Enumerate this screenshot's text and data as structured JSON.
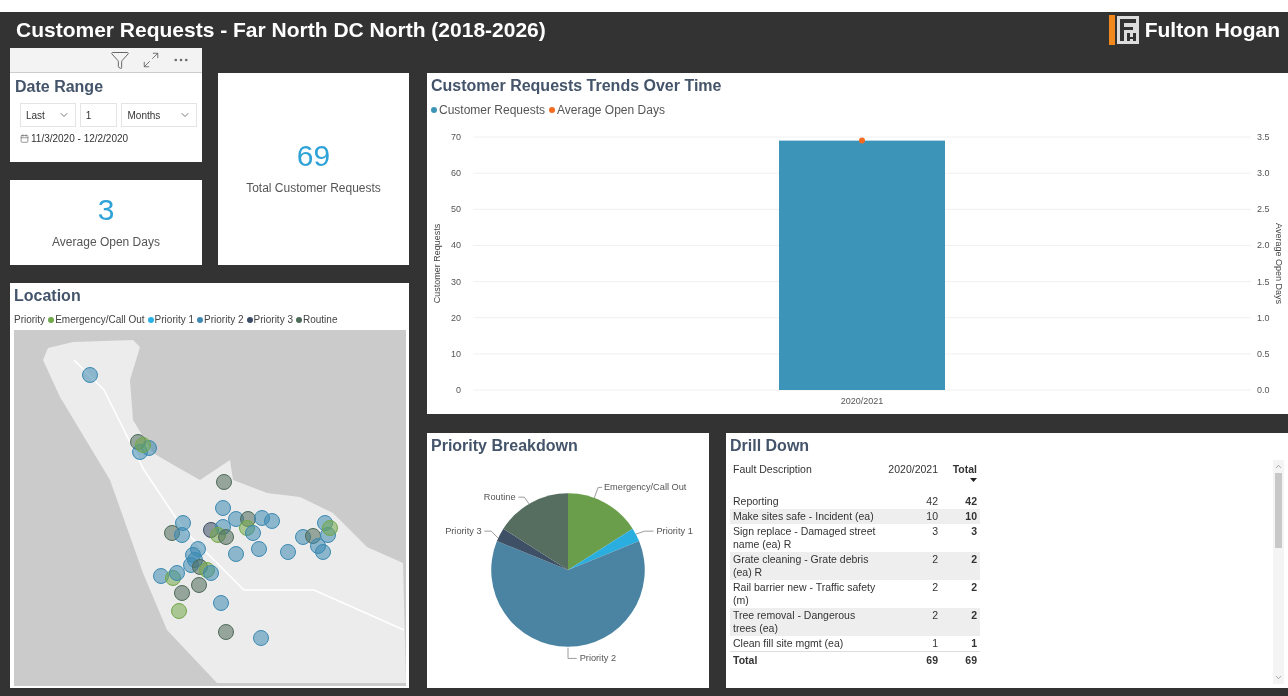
{
  "header": {
    "title": "Customer Requests - Far North DC North (2018-2026)",
    "logo_text": "Fulton Hogan"
  },
  "date_range": {
    "title": "Date Range",
    "fields": [
      {
        "kind": "dropdown",
        "value": "Last"
      },
      {
        "kind": "input",
        "value": "1"
      },
      {
        "kind": "dropdown",
        "value": "Months"
      }
    ],
    "range_text": "11/3/2020 - 12/2/2020"
  },
  "average_card": {
    "value": "3",
    "label": "Average Open Days"
  },
  "total_card": {
    "value": "69",
    "label": "Total Customer Requests"
  },
  "location": {
    "title": "Location",
    "legend_title": "Priority",
    "legend": [
      {
        "label": "Emergency/Call Out",
        "color": "#72a84a"
      },
      {
        "label": "Priority 1",
        "color": "#27b1e6"
      },
      {
        "label": "Priority 2",
        "color": "#3d8ab3"
      },
      {
        "label": "Priority 3",
        "color": "#3c4e66"
      },
      {
        "label": "Routine",
        "color": "#4f6b5a"
      }
    ]
  },
  "trends": {
    "title": "Customer Requests Trends Over Time",
    "chart_data": {
      "type": "bar",
      "categories": [
        "2020/2021"
      ],
      "ylabel": "Customer Requests",
      "ylim": [
        0,
        70
      ],
      "yticks": [
        0,
        10,
        20,
        30,
        40,
        50,
        60,
        70
      ],
      "grid": true,
      "series": [
        {
          "name": "Customer Requests",
          "color": "#3d94b9",
          "values": [
            69
          ]
        }
      ]
    },
    "secondary": {
      "name": "Average Open Days",
      "color": "#f36b21",
      "axis_title": "Average Open Days",
      "axis_ticks": [
        "3.5",
        "3.0",
        "2.5",
        "2.0",
        "1.5",
        "1.0",
        "0.5",
        "0.0"
      ]
    }
  },
  "priority": {
    "title": "Priority Breakdown",
    "slices": [
      {
        "label": "Emergency/Call Out",
        "color": "#6a9e4a"
      },
      {
        "label": "Priority 1",
        "color": "#2aaee0"
      },
      {
        "label": "Priority 2",
        "color": "#4a84a2"
      },
      {
        "label": "Priority 3",
        "color": "#3e5066"
      },
      {
        "label": "Routine",
        "color": "#566e60"
      }
    ]
  },
  "drill_down": {
    "title": "Drill Down",
    "columns": [
      {
        "label": "Fault Description",
        "sorted": false
      },
      {
        "label": "2020/2021",
        "sorted": false
      },
      {
        "label": "Total",
        "sorted": true
      }
    ],
    "rows": [
      [
        "Reporting",
        "42",
        "42"
      ],
      [
        "Make sites safe - Incident (ea)",
        "10",
        "10"
      ],
      [
        "Sign replace - Damaged street name (ea) R",
        "3",
        "3"
      ],
      [
        "Grate cleaning - Grate debris (ea) R",
        "2",
        "2"
      ],
      [
        "Rail barrier new - Traffic safety (m)",
        "2",
        "2"
      ],
      [
        "Tree removal - Dangerous trees (ea)",
        "2",
        "2"
      ],
      [
        "Clean fill site mgmt (ea)",
        "1",
        "1"
      ]
    ],
    "total_row": [
      "Total",
      "69",
      "69"
    ]
  }
}
